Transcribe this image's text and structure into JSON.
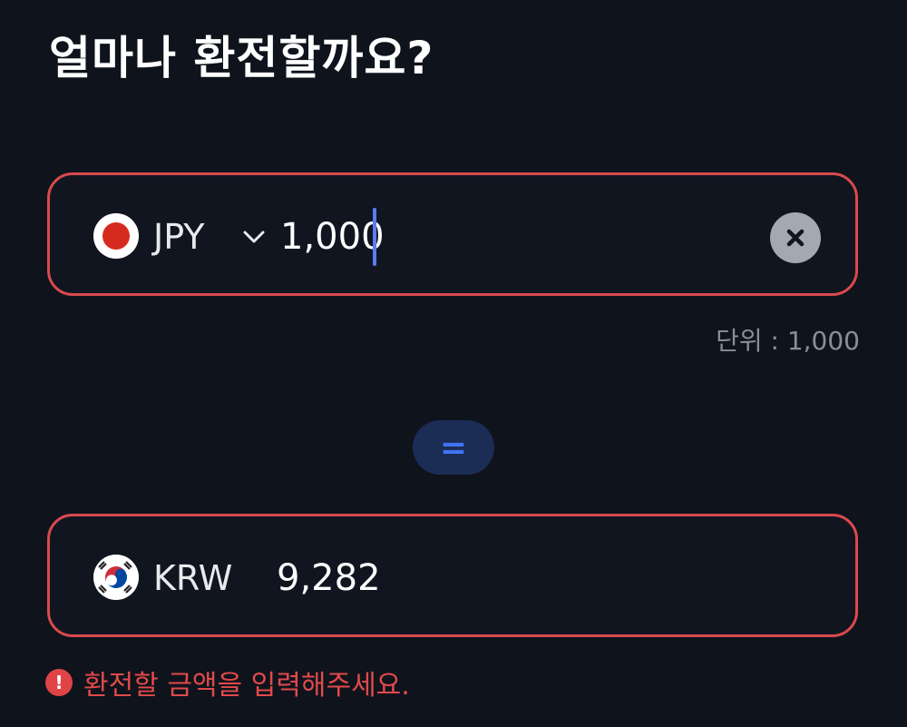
{
  "title": "얼마나 환전할까요?",
  "from_currency": {
    "code": "JPY",
    "flag": "japan-flag",
    "amount": "1,000",
    "clear_icon": "close-icon"
  },
  "unit_note": "단위 : 1,000",
  "equals_symbol": "=",
  "to_currency": {
    "code": "KRW",
    "flag": "south-korea-flag",
    "amount": "9,282"
  },
  "error": {
    "icon": "!",
    "message": "환전할 금액을 입력해주세요."
  },
  "colors": {
    "background": "#0f131c",
    "error_border": "#d94a4d",
    "error_text": "#e14a4b",
    "accent_blue": "#3f74f0",
    "caret": "#5b7cf5"
  }
}
